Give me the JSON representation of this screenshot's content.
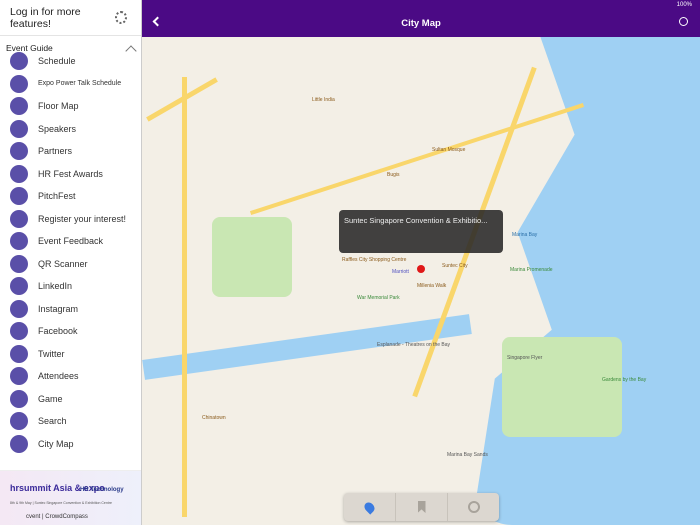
{
  "sidebar": {
    "login": "Log in for more features!",
    "section": "Event Guide",
    "items": [
      {
        "label": "Schedule",
        "color": "#5a4fa8"
      },
      {
        "label": "Expo Power Talk Schedule",
        "color": "#5a4fa8"
      },
      {
        "label": "Floor Map",
        "color": "#5a4fa8"
      },
      {
        "label": "Speakers",
        "color": "#5a4fa8"
      },
      {
        "label": "Partners",
        "color": "#5a4fa8"
      },
      {
        "label": "HR Fest Awards",
        "color": "#5a4fa8"
      },
      {
        "label": "PitchFest",
        "color": "#5a4fa8"
      },
      {
        "label": "Register your interest!",
        "color": "#5a4fa8"
      },
      {
        "label": "Event Feedback",
        "color": "#5a4fa8"
      },
      {
        "label": "QR Scanner",
        "color": "#5a4fa8"
      },
      {
        "label": "LinkedIn",
        "color": "#5a4fa8"
      },
      {
        "label": "Instagram",
        "color": "#5a4fa8"
      },
      {
        "label": "Facebook",
        "color": "#5a4fa8"
      },
      {
        "label": "Twitter",
        "color": "#5a4fa8"
      },
      {
        "label": "Attendees",
        "color": "#5a4fa8"
      },
      {
        "label": "Game",
        "color": "#5a4fa8"
      },
      {
        "label": "Search",
        "color": "#5a4fa8"
      },
      {
        "label": "City Map",
        "color": "#5a4fa8"
      }
    ],
    "banner": {
      "brand": "hrsummit Asia & expo",
      "partner": "HR Technology",
      "date": "8th & 9th May | Suntec Singapore Convention & Exhibition Centre",
      "footer": "cvent | CrowdCompass"
    }
  },
  "topbar": {
    "title": "City Map",
    "status": "100%",
    "color": "#4b0a85"
  },
  "map": {
    "callout": "Suntec Singapore Convention & Exhibitio...",
    "labels": [
      "Little India",
      "Sultan Mosque",
      "Marriott",
      "Suntec City",
      "Raffles City Shopping Centre",
      "Marina Bay",
      "Esplanade - Theatres on the Bay",
      "Singapore Flyer",
      "Marina Bay Sands",
      "Gardens by the Bay",
      "Chinatown",
      "Marina Promenade",
      "War Memorial Park",
      "Millenia Walk",
      "Bugis"
    ]
  },
  "toolbar": {
    "icons": [
      "location-pin-icon",
      "bookmark-icon",
      "alarm-clock-icon"
    ]
  }
}
